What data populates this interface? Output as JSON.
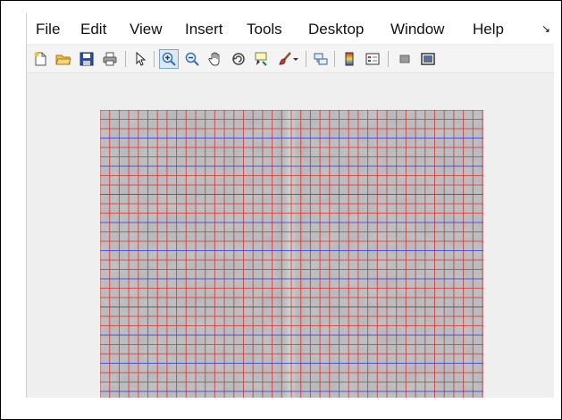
{
  "menu": {
    "items": [
      "File",
      "Edit",
      "View",
      "Insert",
      "Tools",
      "Desktop",
      "Window",
      "Help"
    ],
    "overflow_glyph": "↘"
  },
  "toolbar": {
    "buttons": [
      {
        "name": "new-figure-icon",
        "active": false
      },
      {
        "name": "open-file-icon",
        "active": false
      },
      {
        "name": "save-icon",
        "active": false
      },
      {
        "name": "print-icon",
        "active": false
      },
      {
        "name": "pointer-icon",
        "active": false
      },
      {
        "name": "zoom-in-icon",
        "active": true
      },
      {
        "name": "zoom-out-icon",
        "active": false
      },
      {
        "name": "pan-hand-icon",
        "active": false
      },
      {
        "name": "rotate-3d-icon",
        "active": false
      },
      {
        "name": "data-cursor-icon",
        "active": false
      },
      {
        "name": "brush-icon",
        "active": false
      },
      {
        "name": "link-plot-icon",
        "active": false
      },
      {
        "name": "colorbar-icon",
        "active": false
      },
      {
        "name": "legend-icon",
        "active": false
      },
      {
        "name": "hide-plot-tools-icon",
        "active": false
      },
      {
        "name": "show-plot-tools-icon",
        "active": false
      }
    ]
  },
  "figure": {
    "image_description_colors": {
      "grid_red": "#d23a3a",
      "grid_blue": "#3a3ad2",
      "background": "#efefef"
    }
  }
}
